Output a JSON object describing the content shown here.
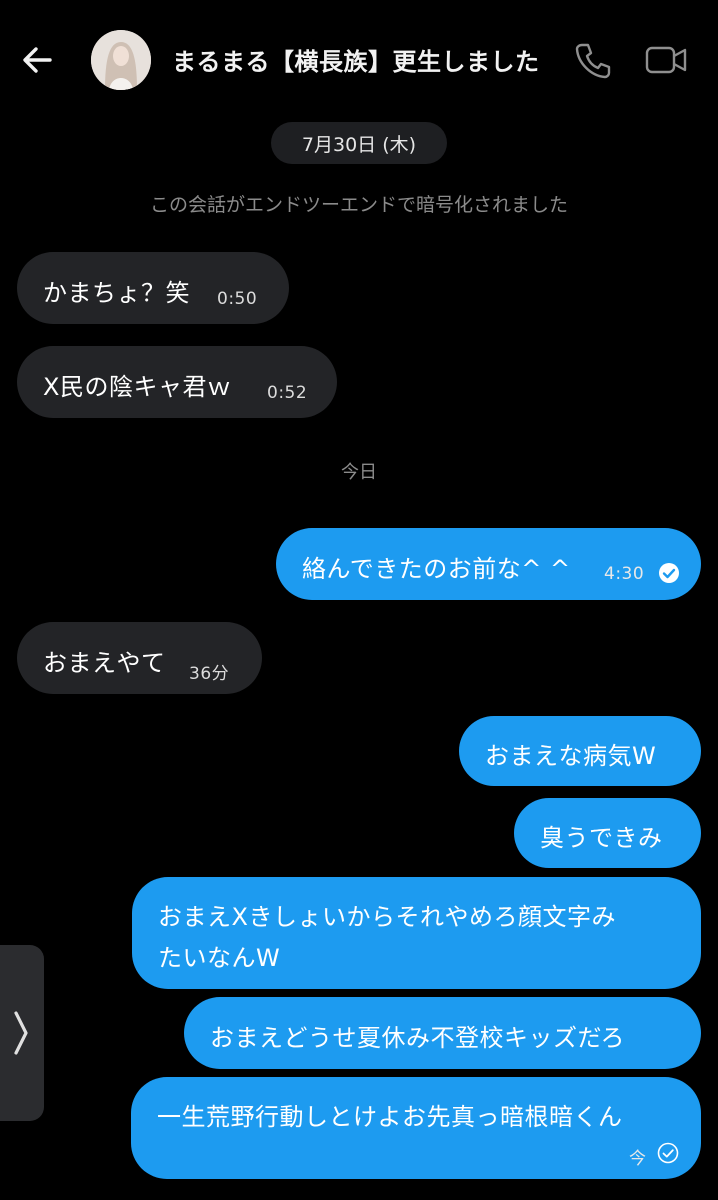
{
  "header": {
    "title": "まるまる【横長族】更生しました"
  },
  "date_chip": "7月30日 (木)",
  "e2e_notice": "この会話がエンドツーエンドで暗号化されました",
  "today_label": "今日",
  "messages": [
    {
      "dir": "in",
      "text": "かまちょ？笑",
      "time": "0:50"
    },
    {
      "dir": "in",
      "text": "X民の陰キャ君ｗ",
      "time": "0:52"
    },
    {
      "dir": "out",
      "text": "絡んできたのお前な^ ^",
      "time": "4:30",
      "status": "read"
    },
    {
      "dir": "in",
      "text": "おまえやて",
      "time": "36分"
    },
    {
      "dir": "out",
      "text": "おまえな病気W"
    },
    {
      "dir": "out",
      "text": "臭うできみ"
    },
    {
      "dir": "out",
      "lines": [
        "おまえXきしょいからそれやめろ顔文字み",
        "たいなんW"
      ]
    },
    {
      "dir": "out",
      "text": "おまえどうせ夏休み不登校キッズだろ"
    },
    {
      "dir": "out",
      "text": "一生荒野行動しとけよお先真っ暗根暗くん",
      "time": "今",
      "status": "sent"
    }
  ],
  "icons": [
    "back-arrow-icon",
    "phone-icon",
    "video-camera-icon",
    "check-circle-icon",
    "chevron-right-icon"
  ],
  "colors": {
    "outgoing": "#1d9bf0",
    "incoming": "#232427",
    "background": "#000000"
  }
}
